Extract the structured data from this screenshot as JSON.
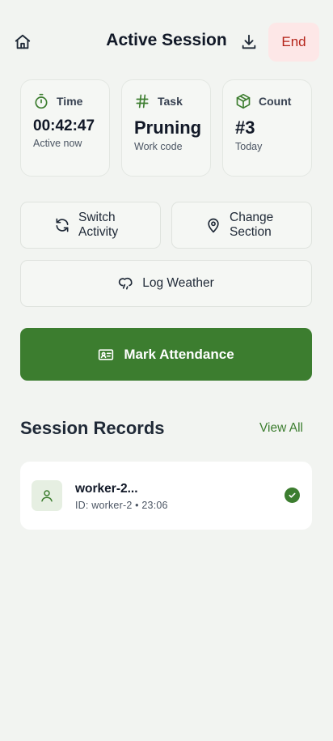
{
  "header": {
    "title": "Active Session",
    "end_label": "End",
    "icons": {
      "home": "home-icon",
      "download": "download-icon"
    }
  },
  "stats": {
    "time": {
      "label": "Time",
      "value": "00:42:47",
      "sub": "Active now",
      "icon": "stopwatch-icon"
    },
    "task": {
      "label": "Task",
      "value": "Pruning",
      "sub": "Work code",
      "icon": "hash-icon"
    },
    "count": {
      "label": "Count",
      "value": "#3",
      "sub": "Today",
      "icon": "package-icon"
    }
  },
  "actions": {
    "switch_activity": {
      "label": "Switch Activity",
      "icon": "refresh-icon"
    },
    "change_section": {
      "label": "Change Section",
      "icon": "map-pin-icon"
    },
    "log_weather": {
      "label": "Log Weather",
      "icon": "cloud-drizzle-icon"
    },
    "mark_attendance": {
      "label": "Mark Attendance",
      "icon": "id-card-icon"
    }
  },
  "records": {
    "title": "Session Records",
    "view_all": "View All",
    "items": [
      {
        "name": "worker-2...",
        "meta": "ID: worker-2 • 23:06",
        "status": "checked"
      }
    ]
  },
  "colors": {
    "accent": "#3c7d2f",
    "danger_text": "#b42318",
    "danger_bg": "#fde7e7",
    "background": "#f2f4f1"
  }
}
